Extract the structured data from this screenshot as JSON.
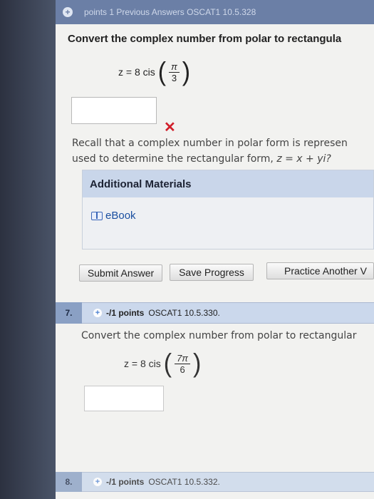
{
  "prev_question": {
    "header_text": "points  1  Previous Answers  OSCAT1 10.5.328"
  },
  "q6": {
    "prompt": "Convert the complex number from polar to rectangula",
    "formula_lhs": "z = 8 cis",
    "frac_num": "π",
    "frac_den": "3",
    "answer_value": "",
    "hint_line1": "Recall that a complex number in polar form is represen",
    "hint_line2_prefix": "used to determine the rectangular form,",
    "hint_line2_expr": "z = x + yi?",
    "materials_title": "Additional Materials",
    "ebook_label": "eBook",
    "submit_label": "Submit Answer",
    "save_label": "Save Progress",
    "practice_label": "Practice Another V"
  },
  "q7": {
    "number": "7.",
    "points": "-/1 points",
    "code": "OSCAT1 10.5.330.",
    "prompt": "Convert the complex number from polar to rectangular",
    "formula_lhs": "z = 8 cis",
    "frac_num": "7π",
    "frac_den": "6",
    "answer_value": ""
  },
  "q8": {
    "number": "8.",
    "points": "-/1 points",
    "code": "OSCAT1 10.5.332."
  },
  "colors": {
    "incorrect": "#d11f2a",
    "header_bg": "#cbd8ec",
    "link": "#1a4fa0"
  }
}
